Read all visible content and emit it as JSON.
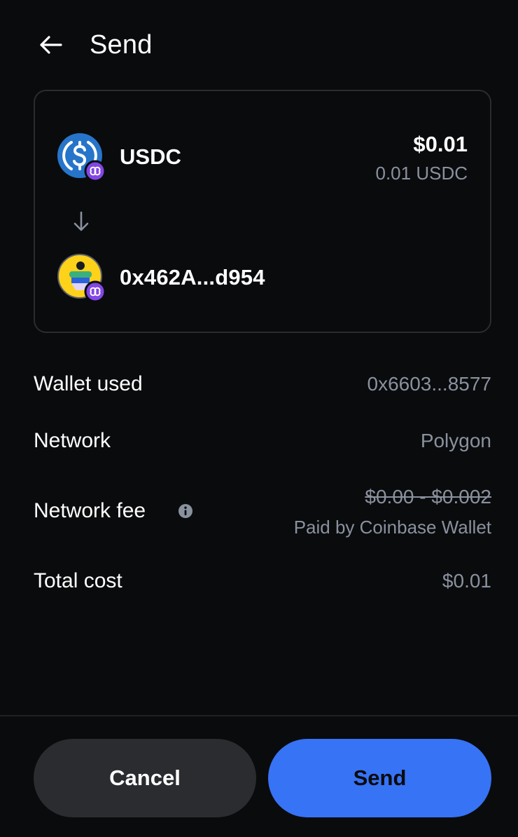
{
  "header": {
    "title": "Send",
    "back_icon": "arrow-left-icon"
  },
  "card": {
    "asset": {
      "name": "USDC",
      "fiat_amount": "$0.01",
      "token_amount": "0.01 USDC",
      "icon": "usdc-icon",
      "badge_icon": "polygon-icon",
      "icon_color": "#2775ca"
    },
    "direction_icon": "arrow-down-icon",
    "recipient": {
      "address": "0x462A...d954",
      "icon": "avatar-icon",
      "badge_icon": "polygon-icon"
    }
  },
  "details": {
    "wallet_used": {
      "label": "Wallet used",
      "value": "0x6603...8577"
    },
    "network": {
      "label": "Network",
      "value": "Polygon"
    },
    "network_fee": {
      "label": "Network fee",
      "value": "$0.00 - $0.002",
      "note": "Paid by Coinbase Wallet",
      "info_icon": "info-icon"
    },
    "total_cost": {
      "label": "Total cost",
      "value": "$0.01"
    }
  },
  "footer": {
    "cancel_label": "Cancel",
    "send_label": "Send"
  },
  "colors": {
    "background": "#0a0b0d",
    "primary": "#3773f5",
    "secondary_button": "#2a2c30",
    "muted_text": "#8a919e",
    "polygon_purple": "#8247e5"
  }
}
